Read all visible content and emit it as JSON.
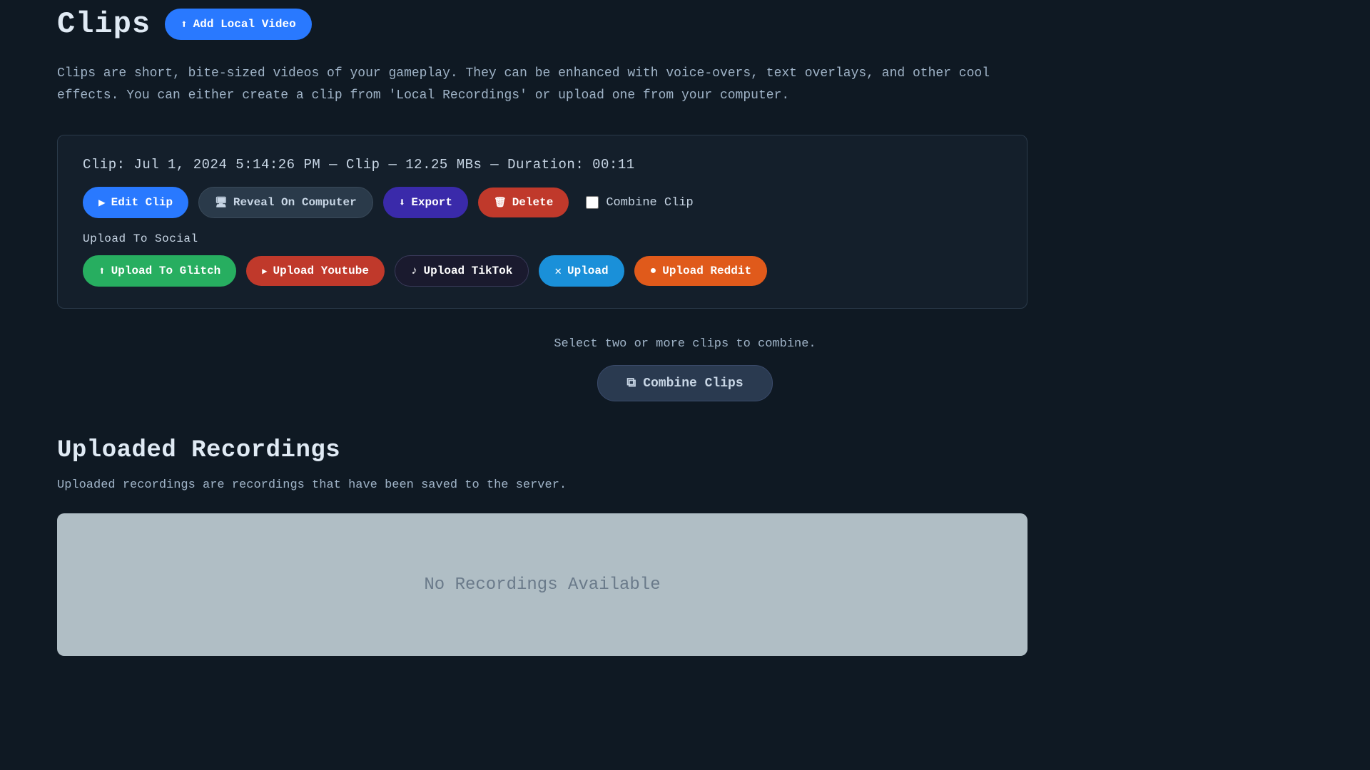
{
  "header": {
    "title": "Clips",
    "add_local_btn": "Add Local Video"
  },
  "description": "Clips are short, bite-sized videos of your gameplay. They can be enhanced with voice-overs, text overlays, and other cool effects. You can either create a clip from 'Local Recordings' or upload one from your computer.",
  "clip": {
    "label": "Clip:",
    "info": "Jul 1, 2024 5:14:26 PM — Clip — 12.25 MBs — Duration: 00:11",
    "edit_btn": "Edit Clip",
    "reveal_btn": "Reveal On Computer",
    "export_btn": "Export",
    "delete_btn": "Delete",
    "combine_label": "Combine Clip",
    "upload_social_label": "Upload To Social",
    "upload_glitch_btn": "Upload To Glitch",
    "upload_youtube_btn": "Upload Youtube",
    "upload_tiktok_btn": "Upload TikTok",
    "upload_x_btn": "Upload",
    "upload_reddit_btn": "Upload Reddit"
  },
  "combine_section": {
    "hint": "Select two or more clips to combine.",
    "combine_btn": "Combine Clips"
  },
  "uploaded_recordings": {
    "title": "Uploaded Recordings",
    "description": "Uploaded recordings are recordings that have been saved to the server.",
    "empty_text": "No Recordings Available"
  },
  "colors": {
    "background": "#0f1923",
    "card_bg": "#141f2b",
    "text_primary": "#e0eaf4",
    "text_secondary": "#a0b4c8",
    "btn_blue": "#2979ff",
    "btn_purple": "#3a2aaa",
    "btn_red": "#c0392b",
    "btn_green": "#27ae60",
    "btn_dark": "#2a3a4a",
    "btn_tiktok": "#1a1a2e",
    "btn_x": "#1a90d9",
    "btn_reddit": "#e05a1b"
  }
}
